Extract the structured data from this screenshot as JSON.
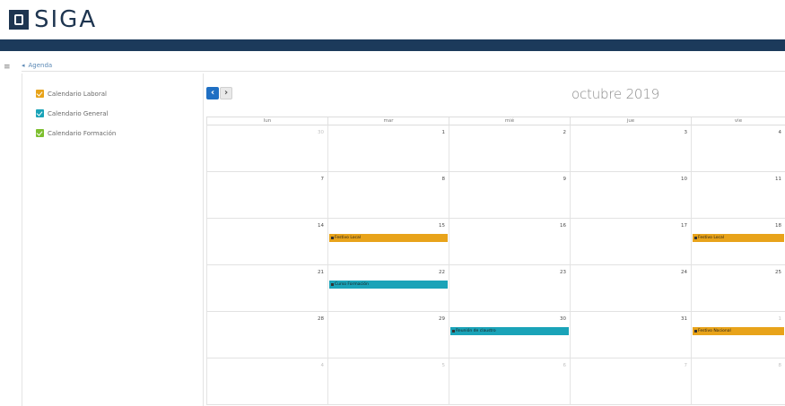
{
  "app": {
    "logo_text": "SIGA"
  },
  "breadcrumb": {
    "home_glyph": "◂",
    "label": "Agenda"
  },
  "legend": {
    "items": [
      {
        "label": "Calendario Laboral",
        "color": "#e8a31a"
      },
      {
        "label": "Calendario General",
        "color": "#1aa3b8"
      },
      {
        "label": "Calendario Formación",
        "color": "#7dbf2f"
      }
    ]
  },
  "calendar": {
    "title": "octubre 2019",
    "prev_glyph": "‹",
    "next_glyph": "›",
    "weekdays": [
      "lun",
      "mar",
      "mié",
      "jue",
      "vie"
    ],
    "weeks": [
      {
        "days": [
          {
            "n": "30",
            "other": true
          },
          {
            "n": "1"
          },
          {
            "n": "2"
          },
          {
            "n": "3"
          },
          {
            "n": "4"
          }
        ]
      },
      {
        "days": [
          {
            "n": "7"
          },
          {
            "n": "8"
          },
          {
            "n": "9"
          },
          {
            "n": "10"
          },
          {
            "n": "11"
          }
        ]
      },
      {
        "days": [
          {
            "n": "14"
          },
          {
            "n": "15"
          },
          {
            "n": "16"
          },
          {
            "n": "17"
          },
          {
            "n": "18"
          }
        ]
      },
      {
        "days": [
          {
            "n": "21"
          },
          {
            "n": "22"
          },
          {
            "n": "23"
          },
          {
            "n": "24"
          },
          {
            "n": "25"
          }
        ]
      },
      {
        "days": [
          {
            "n": "28"
          },
          {
            "n": "29"
          },
          {
            "n": "30"
          },
          {
            "n": "31"
          },
          {
            "n": "1",
            "other": true
          }
        ]
      },
      {
        "days": [
          {
            "n": "4",
            "other": true
          },
          {
            "n": "5",
            "other": true
          },
          {
            "n": "6",
            "other": true
          },
          {
            "n": "7",
            "other": true
          },
          {
            "n": "8",
            "other": true
          }
        ]
      }
    ],
    "events": [
      {
        "title": "Festivo Local",
        "week": 2,
        "day": 1,
        "color": "#e8a31a"
      },
      {
        "title": "Festivo Local",
        "week": 2,
        "day": 4,
        "color": "#e8a31a"
      },
      {
        "title": "Curso Formación",
        "week": 3,
        "day": 1,
        "color": "#1aa3b8"
      },
      {
        "title": "Reunión de claustro",
        "week": 4,
        "day": 2,
        "color": "#1aa3b8"
      },
      {
        "title": "Festivo Nacional",
        "week": 4,
        "day": 4,
        "color": "#e8a31a"
      }
    ]
  }
}
